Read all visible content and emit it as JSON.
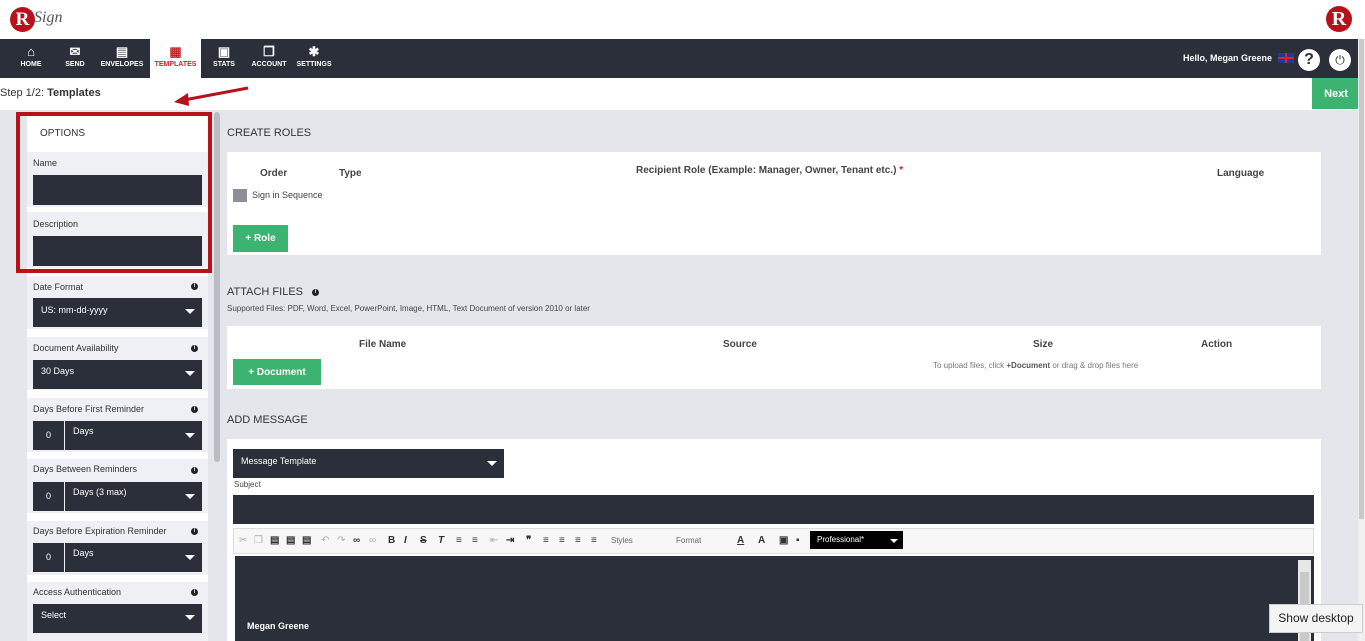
{
  "brand": {
    "logo_letter": "R",
    "logo_word": "Sign",
    "accent": "#b5121b"
  },
  "nav": {
    "items": [
      {
        "label": "HOME",
        "icon": "home-icon",
        "glyph": "⌂"
      },
      {
        "label": "SEND",
        "icon": "envelope-icon",
        "glyph": "✉"
      },
      {
        "label": "ENVELOPES",
        "icon": "inbox-icon",
        "glyph": "▤"
      },
      {
        "label": "TEMPLATES",
        "icon": "templates-icon",
        "glyph": "▦",
        "active": true
      },
      {
        "label": "STATS",
        "icon": "briefcase-icon",
        "glyph": "▣"
      },
      {
        "label": "ACCOUNT",
        "icon": "documents-icon",
        "glyph": "❐"
      },
      {
        "label": "SETTINGS",
        "icon": "gear-icon",
        "glyph": "✱"
      }
    ],
    "greeting": "Hello, Megan Greene",
    "help_glyph": "?",
    "power_glyph": "⏻"
  },
  "step": {
    "prefix": "Step 1/2: ",
    "title": "Templates",
    "next_label": "Next"
  },
  "options": {
    "title": "OPTIONS",
    "name_label": "Name",
    "description_label": "Description",
    "date_format_label": "Date Format",
    "date_format_value": "US: mm-dd-yyyy",
    "availability_label": "Document Availability",
    "availability_value": "30 Days",
    "first_reminder_label": "Days Before First Reminder",
    "first_reminder_num": "0",
    "first_reminder_unit": "Days",
    "between_label": "Days Between Reminders",
    "between_num": "0",
    "between_unit": "Days (3 max)",
    "expiration_label": "Days Before Expiration Reminder",
    "expiration_num": "0",
    "expiration_unit": "Days",
    "auth_label": "Access Authentication",
    "auth_value": "Select",
    "info_glyph": "i"
  },
  "roles": {
    "title": "CREATE ROLES",
    "col_order": "Order",
    "col_type": "Type",
    "col_role": "Recipient Role (Example: Manager, Owner, Tenant etc.)",
    "required_mark": "*",
    "col_language": "Language",
    "sequence_label": "Sign in Sequence",
    "add_role": "+ Role"
  },
  "files": {
    "title": "ATTACH FILES",
    "info_glyph": "i",
    "supported": "Supported Files: PDF, Word, Excel, PowerPoint, Image, HTML, Text Document of version 2010 or later",
    "col_name": "File Name",
    "col_source": "Source",
    "col_size": "Size",
    "col_action": "Action",
    "add_document": "+ Document",
    "hint_pre": "To upload files, click ",
    "hint_bold": "+Document",
    "hint_post": " or drag & drop files here"
  },
  "message": {
    "title": "ADD MESSAGE",
    "template_value": "Message Template",
    "subject_label": "Subject",
    "styles_label": "Styles",
    "format_label": "Format",
    "style_value": "Professional*",
    "signature_name": "Megan Greene"
  },
  "taskbar": {
    "show_desktop": "Show desktop"
  }
}
